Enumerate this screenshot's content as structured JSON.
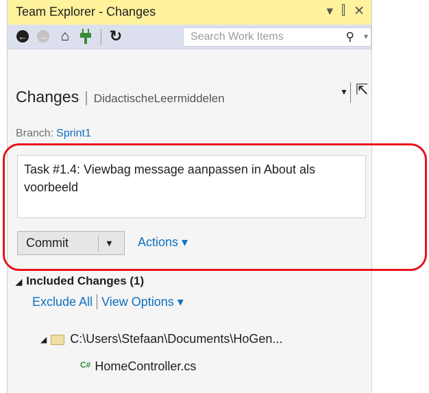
{
  "window": {
    "title": "Team Explorer - Changes",
    "title_buttons": [
      "▾",
      "⫿",
      "✕"
    ]
  },
  "navbar": {
    "search_placeholder": "Search Work Items"
  },
  "header": {
    "page": "Changes",
    "separator": "|",
    "project": "DidactischeLeermiddelen"
  },
  "branch": {
    "label": "Branch:",
    "name": "Sprint1"
  },
  "commit": {
    "message": "Task #1.4: Viewbag message aanpassen in About als voorbeeld",
    "button_label": "Commit",
    "actions_label": "Actions ▾"
  },
  "included": {
    "title": "Included Changes (1)",
    "exclude_all": "Exclude All",
    "view_options": "View Options ▾"
  },
  "tree": {
    "folder_path": "C:\\Users\\Stefaan\\Documents\\HoGen...",
    "file_badge": "C#",
    "file_name": "HomeController.cs"
  },
  "colors": {
    "title_bar": "#fff29d",
    "nav_bar": "#dce0ee",
    "link": "#0e70c0",
    "highlight": "#e8141a"
  }
}
